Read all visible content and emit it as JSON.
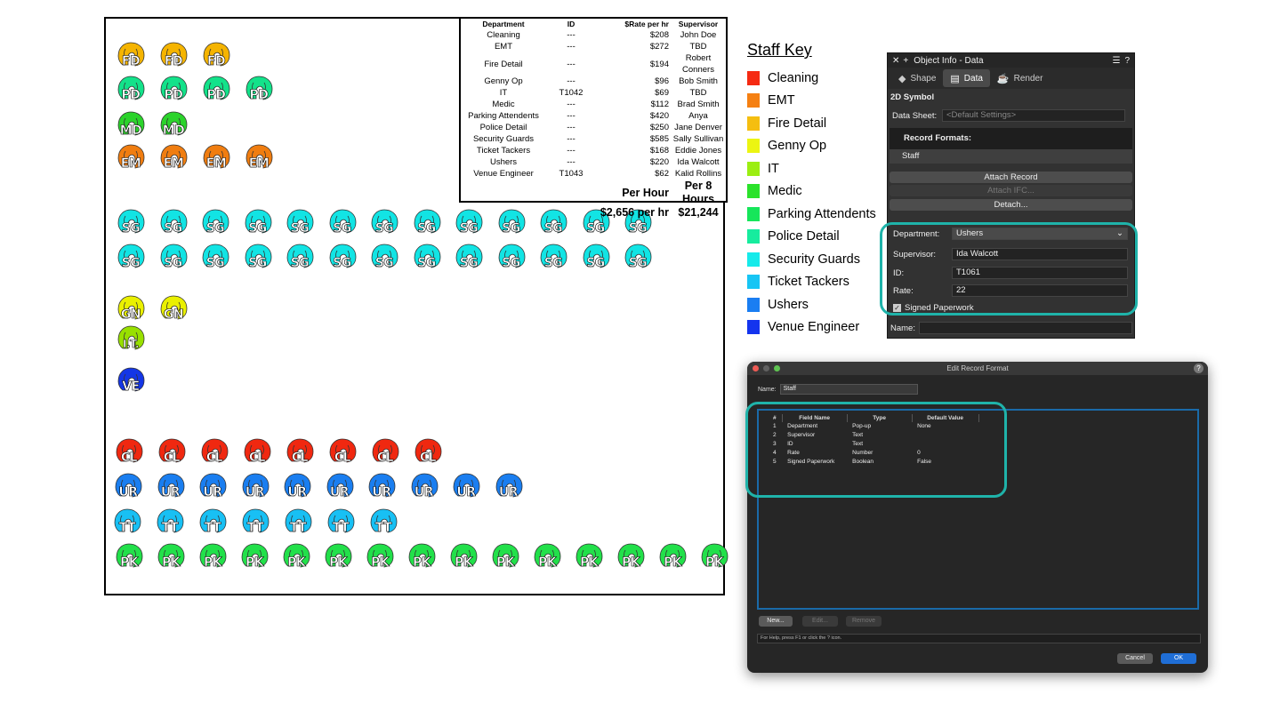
{
  "rate_table": {
    "headers": [
      "Department",
      "ID",
      "$Rate per hr",
      "Supervisor"
    ],
    "rows": [
      [
        "Cleaning",
        "---",
        "$208",
        "John Doe"
      ],
      [
        "EMT",
        "---",
        "$272",
        "TBD"
      ],
      [
        "Fire Detail",
        "---",
        "$194",
        "Robert Conners"
      ],
      [
        "Genny Op",
        "---",
        "$96",
        "Bob Smith"
      ],
      [
        "IT",
        "T1042",
        "$69",
        "TBD"
      ],
      [
        "Medic",
        "---",
        "$112",
        "Brad Smith"
      ],
      [
        "Parking Attendents",
        "---",
        "$420",
        "Anya"
      ],
      [
        "Police Detail",
        "---",
        "$250",
        "Jane Denver"
      ],
      [
        "Security Guards",
        "---",
        "$585",
        "Sally Sullivan"
      ],
      [
        "Ticket Tackers",
        "---",
        "$168",
        "Eddie Jones"
      ],
      [
        "Ushers",
        "---",
        "$220",
        "Ida Walcott"
      ],
      [
        "Venue Engineer",
        "T1043",
        "$62",
        "Kalid Rollins"
      ]
    ],
    "per_hour_label": "Per Hour",
    "per_8_label": "Per 8 Hours",
    "per_hour_value": "$2,656 per hr",
    "per_8_value": "$21,244"
  },
  "symbol_groups": [
    {
      "label": "FD",
      "color": "#f5b400",
      "count": 3
    },
    {
      "label": "PD",
      "color": "#13e28a",
      "count": 4
    },
    {
      "label": "MD",
      "color": "#2bd32b",
      "count": 2
    },
    {
      "label": "EM",
      "color": "#f07d10",
      "count": 4
    },
    {
      "label": "SG",
      "color": "#12e4e4",
      "count": 13
    },
    {
      "label": "SG",
      "color": "#12e4e4",
      "count": 13
    },
    {
      "label": "GN",
      "color": "#eaf000",
      "count": 2
    },
    {
      "label": "I.T.",
      "color": "#98e000",
      "count": 1
    },
    {
      "label": "VE",
      "color": "#1436e6",
      "count": 1
    },
    {
      "label": "CL",
      "color": "#f02810",
      "count": 8
    },
    {
      "label": "UR",
      "color": "#1a7ef0",
      "count": 10
    },
    {
      "label": "TT",
      "color": "#18c0f4",
      "count": 7
    },
    {
      "label": "PK",
      "color": "#22e04a",
      "count": 15
    }
  ],
  "staff_key": {
    "title": "Staff Key",
    "items": [
      {
        "label": "Cleaning",
        "color": "#f52a12"
      },
      {
        "label": "EMT",
        "color": "#f58012"
      },
      {
        "label": "Fire Detail",
        "color": "#f5be10"
      },
      {
        "label": "Genny Op",
        "color": "#ecf512"
      },
      {
        "label": "IT",
        "color": "#9bee12"
      },
      {
        "label": "Medic",
        "color": "#2be22b"
      },
      {
        "label": "Parking Attendents",
        "color": "#16e65a"
      },
      {
        "label": "Police Detail",
        "color": "#17ec9e"
      },
      {
        "label": "Security Guards",
        "color": "#16eaea"
      },
      {
        "label": "Ticket Tackers",
        "color": "#17c5f4"
      },
      {
        "label": "Ushers",
        "color": "#1a7ef2"
      },
      {
        "label": "Venue Engineer",
        "color": "#1434ee"
      }
    ]
  },
  "oip": {
    "title": "Object Info - Data",
    "tabs": [
      "Shape",
      "Data",
      "Render"
    ],
    "symbol_type": "2D Symbol",
    "data_sheet_label": "Data Sheet:",
    "data_sheet_value": "<Default Settings>",
    "record_formats_label": "Record Formats:",
    "record_item": "Staff",
    "attach_record": "Attach Record",
    "attach_ifc": "Attach IFC...",
    "detach": "Detach...",
    "department_label": "Department:",
    "department_value": "Ushers",
    "supervisor_label": "Supervisor:",
    "supervisor_value": "Ida Walcott",
    "id_label": "ID:",
    "id_value": "T1061",
    "rate_label": "Rate:",
    "rate_value": "22",
    "signed_label": "Signed Paperwork",
    "name_label": "Name:",
    "name_value": ""
  },
  "erf": {
    "title": "Edit Record Format",
    "name_label": "Name:",
    "name_value": "Staff",
    "columns": [
      "#",
      "Field Name",
      "Type",
      "Default Value"
    ],
    "rows": [
      [
        "1",
        "Department",
        "Pop-up",
        "None"
      ],
      [
        "2",
        "Supervisor",
        "Text",
        ""
      ],
      [
        "3",
        "ID",
        "Text",
        ""
      ],
      [
        "4",
        "Rate",
        "Number",
        "0"
      ],
      [
        "5",
        "Signed Paperwork",
        "Boolean",
        "False"
      ]
    ],
    "new_btn": "New...",
    "edit_btn": "Edit...",
    "remove_btn": "Remove",
    "help_text": "For Help, press F1 or click the ? icon.",
    "cancel_btn": "Cancel",
    "ok_btn": "OK"
  }
}
